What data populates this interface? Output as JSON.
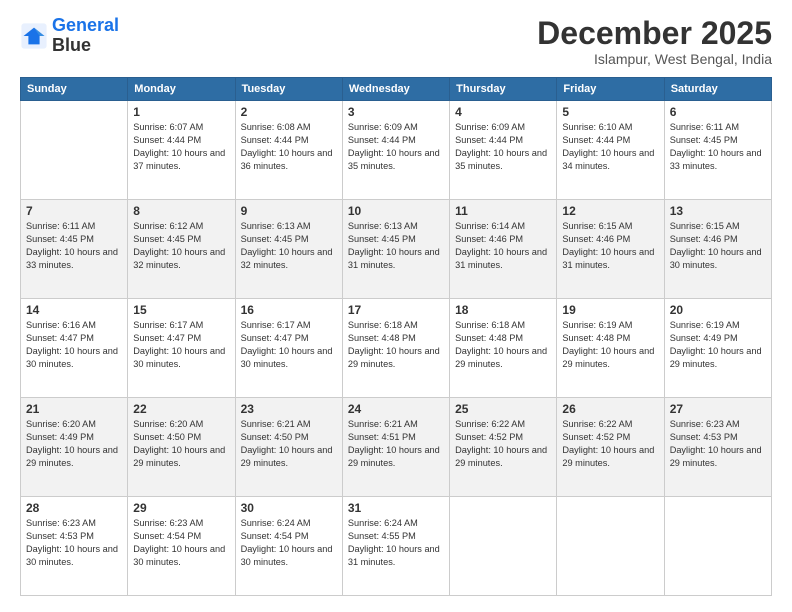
{
  "header": {
    "logo_line1": "General",
    "logo_line2": "Blue",
    "month": "December 2025",
    "location": "Islampur, West Bengal, India"
  },
  "weekdays": [
    "Sunday",
    "Monday",
    "Tuesday",
    "Wednesday",
    "Thursday",
    "Friday",
    "Saturday"
  ],
  "weeks": [
    [
      {
        "day": "",
        "sunrise": "",
        "sunset": "",
        "daylight": ""
      },
      {
        "day": "1",
        "sunrise": "Sunrise: 6:07 AM",
        "sunset": "Sunset: 4:44 PM",
        "daylight": "Daylight: 10 hours and 37 minutes."
      },
      {
        "day": "2",
        "sunrise": "Sunrise: 6:08 AM",
        "sunset": "Sunset: 4:44 PM",
        "daylight": "Daylight: 10 hours and 36 minutes."
      },
      {
        "day": "3",
        "sunrise": "Sunrise: 6:09 AM",
        "sunset": "Sunset: 4:44 PM",
        "daylight": "Daylight: 10 hours and 35 minutes."
      },
      {
        "day": "4",
        "sunrise": "Sunrise: 6:09 AM",
        "sunset": "Sunset: 4:44 PM",
        "daylight": "Daylight: 10 hours and 35 minutes."
      },
      {
        "day": "5",
        "sunrise": "Sunrise: 6:10 AM",
        "sunset": "Sunset: 4:44 PM",
        "daylight": "Daylight: 10 hours and 34 minutes."
      },
      {
        "day": "6",
        "sunrise": "Sunrise: 6:11 AM",
        "sunset": "Sunset: 4:45 PM",
        "daylight": "Daylight: 10 hours and 33 minutes."
      }
    ],
    [
      {
        "day": "7",
        "sunrise": "Sunrise: 6:11 AM",
        "sunset": "Sunset: 4:45 PM",
        "daylight": "Daylight: 10 hours and 33 minutes."
      },
      {
        "day": "8",
        "sunrise": "Sunrise: 6:12 AM",
        "sunset": "Sunset: 4:45 PM",
        "daylight": "Daylight: 10 hours and 32 minutes."
      },
      {
        "day": "9",
        "sunrise": "Sunrise: 6:13 AM",
        "sunset": "Sunset: 4:45 PM",
        "daylight": "Daylight: 10 hours and 32 minutes."
      },
      {
        "day": "10",
        "sunrise": "Sunrise: 6:13 AM",
        "sunset": "Sunset: 4:45 PM",
        "daylight": "Daylight: 10 hours and 31 minutes."
      },
      {
        "day": "11",
        "sunrise": "Sunrise: 6:14 AM",
        "sunset": "Sunset: 4:46 PM",
        "daylight": "Daylight: 10 hours and 31 minutes."
      },
      {
        "day": "12",
        "sunrise": "Sunrise: 6:15 AM",
        "sunset": "Sunset: 4:46 PM",
        "daylight": "Daylight: 10 hours and 31 minutes."
      },
      {
        "day": "13",
        "sunrise": "Sunrise: 6:15 AM",
        "sunset": "Sunset: 4:46 PM",
        "daylight": "Daylight: 10 hours and 30 minutes."
      }
    ],
    [
      {
        "day": "14",
        "sunrise": "Sunrise: 6:16 AM",
        "sunset": "Sunset: 4:47 PM",
        "daylight": "Daylight: 10 hours and 30 minutes."
      },
      {
        "day": "15",
        "sunrise": "Sunrise: 6:17 AM",
        "sunset": "Sunset: 4:47 PM",
        "daylight": "Daylight: 10 hours and 30 minutes."
      },
      {
        "day": "16",
        "sunrise": "Sunrise: 6:17 AM",
        "sunset": "Sunset: 4:47 PM",
        "daylight": "Daylight: 10 hours and 30 minutes."
      },
      {
        "day": "17",
        "sunrise": "Sunrise: 6:18 AM",
        "sunset": "Sunset: 4:48 PM",
        "daylight": "Daylight: 10 hours and 29 minutes."
      },
      {
        "day": "18",
        "sunrise": "Sunrise: 6:18 AM",
        "sunset": "Sunset: 4:48 PM",
        "daylight": "Daylight: 10 hours and 29 minutes."
      },
      {
        "day": "19",
        "sunrise": "Sunrise: 6:19 AM",
        "sunset": "Sunset: 4:48 PM",
        "daylight": "Daylight: 10 hours and 29 minutes."
      },
      {
        "day": "20",
        "sunrise": "Sunrise: 6:19 AM",
        "sunset": "Sunset: 4:49 PM",
        "daylight": "Daylight: 10 hours and 29 minutes."
      }
    ],
    [
      {
        "day": "21",
        "sunrise": "Sunrise: 6:20 AM",
        "sunset": "Sunset: 4:49 PM",
        "daylight": "Daylight: 10 hours and 29 minutes."
      },
      {
        "day": "22",
        "sunrise": "Sunrise: 6:20 AM",
        "sunset": "Sunset: 4:50 PM",
        "daylight": "Daylight: 10 hours and 29 minutes."
      },
      {
        "day": "23",
        "sunrise": "Sunrise: 6:21 AM",
        "sunset": "Sunset: 4:50 PM",
        "daylight": "Daylight: 10 hours and 29 minutes."
      },
      {
        "day": "24",
        "sunrise": "Sunrise: 6:21 AM",
        "sunset": "Sunset: 4:51 PM",
        "daylight": "Daylight: 10 hours and 29 minutes."
      },
      {
        "day": "25",
        "sunrise": "Sunrise: 6:22 AM",
        "sunset": "Sunset: 4:52 PM",
        "daylight": "Daylight: 10 hours and 29 minutes."
      },
      {
        "day": "26",
        "sunrise": "Sunrise: 6:22 AM",
        "sunset": "Sunset: 4:52 PM",
        "daylight": "Daylight: 10 hours and 29 minutes."
      },
      {
        "day": "27",
        "sunrise": "Sunrise: 6:23 AM",
        "sunset": "Sunset: 4:53 PM",
        "daylight": "Daylight: 10 hours and 29 minutes."
      }
    ],
    [
      {
        "day": "28",
        "sunrise": "Sunrise: 6:23 AM",
        "sunset": "Sunset: 4:53 PM",
        "daylight": "Daylight: 10 hours and 30 minutes."
      },
      {
        "day": "29",
        "sunrise": "Sunrise: 6:23 AM",
        "sunset": "Sunset: 4:54 PM",
        "daylight": "Daylight: 10 hours and 30 minutes."
      },
      {
        "day": "30",
        "sunrise": "Sunrise: 6:24 AM",
        "sunset": "Sunset: 4:54 PM",
        "daylight": "Daylight: 10 hours and 30 minutes."
      },
      {
        "day": "31",
        "sunrise": "Sunrise: 6:24 AM",
        "sunset": "Sunset: 4:55 PM",
        "daylight": "Daylight: 10 hours and 31 minutes."
      },
      {
        "day": "",
        "sunrise": "",
        "sunset": "",
        "daylight": ""
      },
      {
        "day": "",
        "sunrise": "",
        "sunset": "",
        "daylight": ""
      },
      {
        "day": "",
        "sunrise": "",
        "sunset": "",
        "daylight": ""
      }
    ]
  ]
}
